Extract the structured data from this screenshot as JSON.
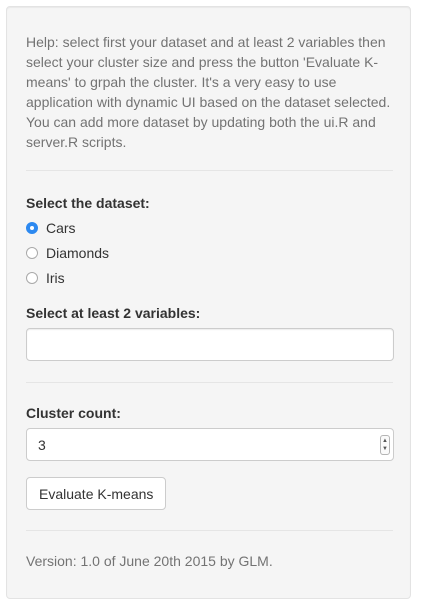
{
  "help_text": "Help: select first your dataset and at least 2 variables then select your cluster size and press the button 'Evaluate K-means' to grpah the cluster. It's a very easy to use application with dynamic UI based on the dataset selected. You can add more dataset by updating both the ui.R and server.R scripts.",
  "dataset": {
    "label": "Select the dataset:",
    "selected": "Cars",
    "options": [
      "Cars",
      "Diamonds",
      "Iris"
    ]
  },
  "variables": {
    "label": "Select at least 2 variables:",
    "value": ""
  },
  "cluster": {
    "label": "Cluster count:",
    "value": "3"
  },
  "evaluate_button": "Evaluate K-means",
  "version_text": "Version: 1.0 of June 20th 2015 by GLM.",
  "colors": {
    "panel_bg": "#f5f5f5",
    "accent": "#2d89f0",
    "muted_text": "#737373"
  },
  "icons": {
    "radio_checked": "radio-checked-icon",
    "radio_unchecked": "radio-unchecked-icon",
    "spinner": "number-spinner-icon"
  }
}
